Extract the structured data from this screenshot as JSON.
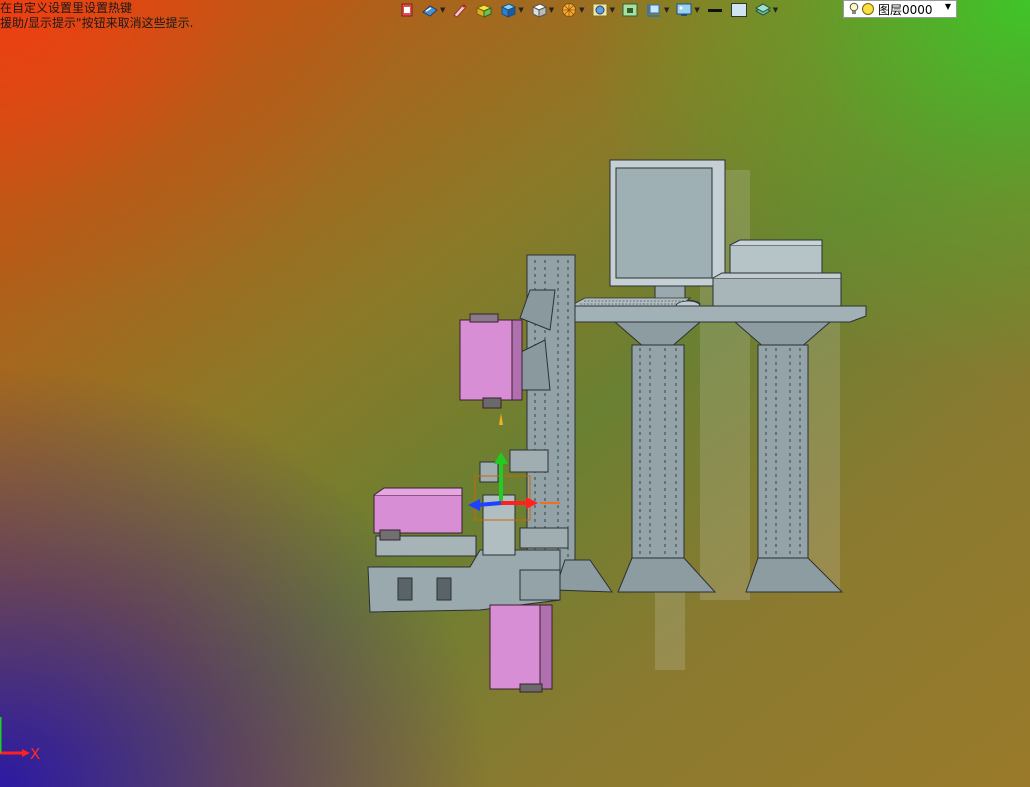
{
  "hints": {
    "line1": "在自定义设置里设置热键",
    "line2": "援助/显示提示\"按钮来取消这些提示."
  },
  "toolbar": {
    "items": [
      {
        "icon": "exit-view-icon"
      },
      {
        "icon": "view-style-icon"
      },
      {
        "icon": "pen-icon"
      },
      {
        "icon": "box-yellow-icon"
      },
      {
        "icon": "box-blue-icon"
      },
      {
        "icon": "cube-view-icon"
      },
      {
        "icon": "section-wheel-icon"
      },
      {
        "icon": "render-icon"
      },
      {
        "icon": "frame-icon"
      },
      {
        "icon": "fit-icon"
      },
      {
        "icon": "display-icon"
      },
      {
        "icon": "line-color-icon"
      },
      {
        "icon": "fill-color-icon"
      },
      {
        "icon": "layers-icon"
      }
    ],
    "line_color": "#111111",
    "fill_color": "#cfe6f2"
  },
  "layer": {
    "name": "图层0000"
  },
  "axis": {
    "x_label": "X"
  },
  "colors": {
    "model_gray": "#9aa9ad",
    "model_edge": "#2a3134",
    "camera_pink": "#d88ed4",
    "axis_red": "#ff2020",
    "axis_green": "#22cc22",
    "axis_blue": "#2040ff"
  }
}
